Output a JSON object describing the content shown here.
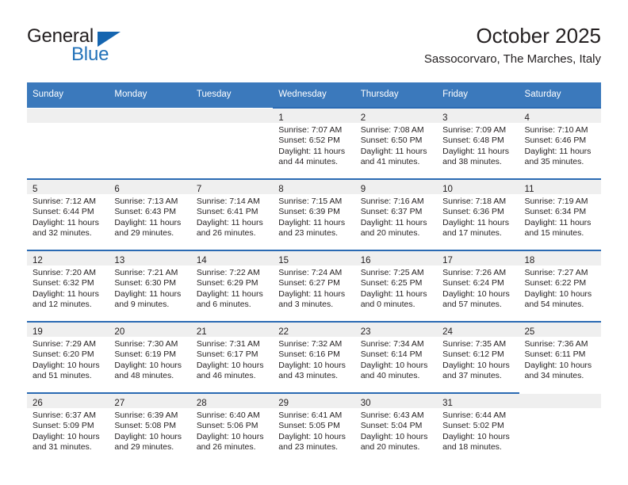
{
  "brand": {
    "word_one": "General",
    "word_two": "Blue",
    "triangle_icon": "brand-triangle-icon"
  },
  "header": {
    "title": "October 2025",
    "subtitle": "Sassocorvaro, The Marches, Italy"
  },
  "colors": {
    "header_blue": "#3b79bc",
    "row_divider_blue": "#2a6ab3",
    "daynum_band_gray": "#efefef",
    "brand_blue": "#2372b9",
    "text": "#231f20"
  },
  "calendar": {
    "weekday_headers": [
      "Sunday",
      "Monday",
      "Tuesday",
      "Wednesday",
      "Thursday",
      "Friday",
      "Saturday"
    ],
    "weeks": [
      [
        {
          "day": "",
          "lines": []
        },
        {
          "day": "",
          "lines": []
        },
        {
          "day": "",
          "lines": []
        },
        {
          "day": "1",
          "lines": [
            "Sunrise: 7:07 AM",
            "Sunset: 6:52 PM",
            "Daylight: 11 hours",
            "and 44 minutes."
          ]
        },
        {
          "day": "2",
          "lines": [
            "Sunrise: 7:08 AM",
            "Sunset: 6:50 PM",
            "Daylight: 11 hours",
            "and 41 minutes."
          ]
        },
        {
          "day": "3",
          "lines": [
            "Sunrise: 7:09 AM",
            "Sunset: 6:48 PM",
            "Daylight: 11 hours",
            "and 38 minutes."
          ]
        },
        {
          "day": "4",
          "lines": [
            "Sunrise: 7:10 AM",
            "Sunset: 6:46 PM",
            "Daylight: 11 hours",
            "and 35 minutes."
          ]
        }
      ],
      [
        {
          "day": "5",
          "lines": [
            "Sunrise: 7:12 AM",
            "Sunset: 6:44 PM",
            "Daylight: 11 hours",
            "and 32 minutes."
          ]
        },
        {
          "day": "6",
          "lines": [
            "Sunrise: 7:13 AM",
            "Sunset: 6:43 PM",
            "Daylight: 11 hours",
            "and 29 minutes."
          ]
        },
        {
          "day": "7",
          "lines": [
            "Sunrise: 7:14 AM",
            "Sunset: 6:41 PM",
            "Daylight: 11 hours",
            "and 26 minutes."
          ]
        },
        {
          "day": "8",
          "lines": [
            "Sunrise: 7:15 AM",
            "Sunset: 6:39 PM",
            "Daylight: 11 hours",
            "and 23 minutes."
          ]
        },
        {
          "day": "9",
          "lines": [
            "Sunrise: 7:16 AM",
            "Sunset: 6:37 PM",
            "Daylight: 11 hours",
            "and 20 minutes."
          ]
        },
        {
          "day": "10",
          "lines": [
            "Sunrise: 7:18 AM",
            "Sunset: 6:36 PM",
            "Daylight: 11 hours",
            "and 17 minutes."
          ]
        },
        {
          "day": "11",
          "lines": [
            "Sunrise: 7:19 AM",
            "Sunset: 6:34 PM",
            "Daylight: 11 hours",
            "and 15 minutes."
          ]
        }
      ],
      [
        {
          "day": "12",
          "lines": [
            "Sunrise: 7:20 AM",
            "Sunset: 6:32 PM",
            "Daylight: 11 hours",
            "and 12 minutes."
          ]
        },
        {
          "day": "13",
          "lines": [
            "Sunrise: 7:21 AM",
            "Sunset: 6:30 PM",
            "Daylight: 11 hours",
            "and 9 minutes."
          ]
        },
        {
          "day": "14",
          "lines": [
            "Sunrise: 7:22 AM",
            "Sunset: 6:29 PM",
            "Daylight: 11 hours",
            "and 6 minutes."
          ]
        },
        {
          "day": "15",
          "lines": [
            "Sunrise: 7:24 AM",
            "Sunset: 6:27 PM",
            "Daylight: 11 hours",
            "and 3 minutes."
          ]
        },
        {
          "day": "16",
          "lines": [
            "Sunrise: 7:25 AM",
            "Sunset: 6:25 PM",
            "Daylight: 11 hours",
            "and 0 minutes."
          ]
        },
        {
          "day": "17",
          "lines": [
            "Sunrise: 7:26 AM",
            "Sunset: 6:24 PM",
            "Daylight: 10 hours",
            "and 57 minutes."
          ]
        },
        {
          "day": "18",
          "lines": [
            "Sunrise: 7:27 AM",
            "Sunset: 6:22 PM",
            "Daylight: 10 hours",
            "and 54 minutes."
          ]
        }
      ],
      [
        {
          "day": "19",
          "lines": [
            "Sunrise: 7:29 AM",
            "Sunset: 6:20 PM",
            "Daylight: 10 hours",
            "and 51 minutes."
          ]
        },
        {
          "day": "20",
          "lines": [
            "Sunrise: 7:30 AM",
            "Sunset: 6:19 PM",
            "Daylight: 10 hours",
            "and 48 minutes."
          ]
        },
        {
          "day": "21",
          "lines": [
            "Sunrise: 7:31 AM",
            "Sunset: 6:17 PM",
            "Daylight: 10 hours",
            "and 46 minutes."
          ]
        },
        {
          "day": "22",
          "lines": [
            "Sunrise: 7:32 AM",
            "Sunset: 6:16 PM",
            "Daylight: 10 hours",
            "and 43 minutes."
          ]
        },
        {
          "day": "23",
          "lines": [
            "Sunrise: 7:34 AM",
            "Sunset: 6:14 PM",
            "Daylight: 10 hours",
            "and 40 minutes."
          ]
        },
        {
          "day": "24",
          "lines": [
            "Sunrise: 7:35 AM",
            "Sunset: 6:12 PM",
            "Daylight: 10 hours",
            "and 37 minutes."
          ]
        },
        {
          "day": "25",
          "lines": [
            "Sunrise: 7:36 AM",
            "Sunset: 6:11 PM",
            "Daylight: 10 hours",
            "and 34 minutes."
          ]
        }
      ],
      [
        {
          "day": "26",
          "lines": [
            "Sunrise: 6:37 AM",
            "Sunset: 5:09 PM",
            "Daylight: 10 hours",
            "and 31 minutes."
          ]
        },
        {
          "day": "27",
          "lines": [
            "Sunrise: 6:39 AM",
            "Sunset: 5:08 PM",
            "Daylight: 10 hours",
            "and 29 minutes."
          ]
        },
        {
          "day": "28",
          "lines": [
            "Sunrise: 6:40 AM",
            "Sunset: 5:06 PM",
            "Daylight: 10 hours",
            "and 26 minutes."
          ]
        },
        {
          "day": "29",
          "lines": [
            "Sunrise: 6:41 AM",
            "Sunset: 5:05 PM",
            "Daylight: 10 hours",
            "and 23 minutes."
          ]
        },
        {
          "day": "30",
          "lines": [
            "Sunrise: 6:43 AM",
            "Sunset: 5:04 PM",
            "Daylight: 10 hours",
            "and 20 minutes."
          ]
        },
        {
          "day": "31",
          "lines": [
            "Sunrise: 6:44 AM",
            "Sunset: 5:02 PM",
            "Daylight: 10 hours",
            "and 18 minutes."
          ]
        },
        {
          "day": "",
          "lines": []
        }
      ]
    ]
  }
}
